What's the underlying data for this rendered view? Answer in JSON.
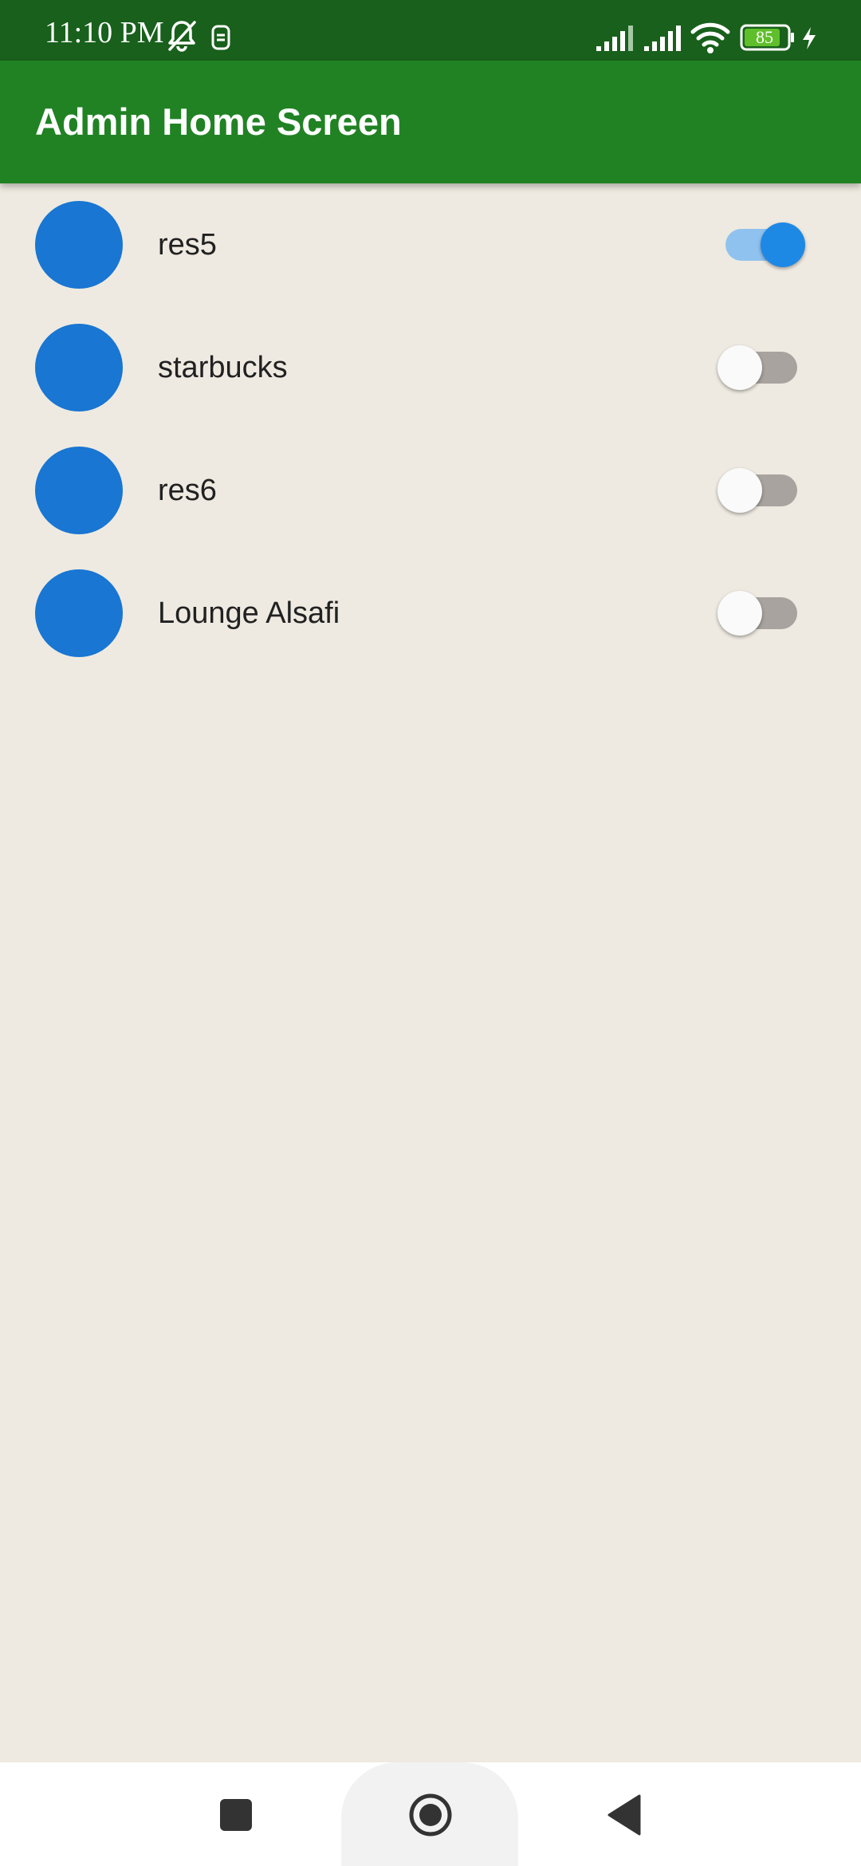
{
  "status_bar": {
    "time": "11:10 PM",
    "battery_level": "85",
    "background_color": "#18601B",
    "icons": [
      "notifications-off-icon",
      "sim-icon",
      "signal-icon",
      "signal-icon",
      "wifi-icon",
      "battery-icon",
      "charging-icon"
    ]
  },
  "app_bar": {
    "title": "Admin Home Screen",
    "background_color": "#218224"
  },
  "restaurants": [
    {
      "name": "res5",
      "enabled": true
    },
    {
      "name": "starbucks",
      "enabled": false
    },
    {
      "name": "res6",
      "enabled": false
    },
    {
      "name": "Lounge Alsafi",
      "enabled": false
    }
  ],
  "colors": {
    "avatar": "#1976D2",
    "switch_on_thumb": "#1E88E5",
    "switch_on_track": "#90C2EF",
    "switch_off_track": "#A8A39E",
    "background": "#EEEAE1"
  },
  "nav_bar": {
    "buttons": [
      "recents-icon",
      "home-icon",
      "back-icon"
    ]
  }
}
